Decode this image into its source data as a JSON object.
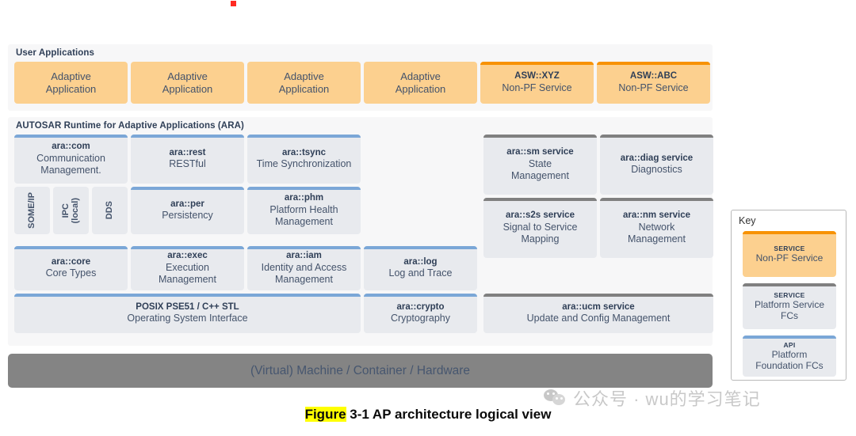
{
  "figure": {
    "caption_highlight": "Figure",
    "caption_rest": " 3-1 AP architecture logical view"
  },
  "watermark": {
    "icon": "wechat-icon",
    "text": "公众号 · wu的学习笔记"
  },
  "colors": {
    "app_fill": "#FCD08F",
    "nonpf_accent": "#F79205",
    "api_fill": "#E8EAEE",
    "api_accent": "#7BA7D7",
    "service_accent": "#808080",
    "panel_bg": "#F7F7F8",
    "hardware_bar": "#848484",
    "caption_highlight": "#FFFF00"
  },
  "user_applications": {
    "title": "User Applications",
    "apps": [
      {
        "kind": "app",
        "title": "",
        "sub": "Adaptive\nApplication"
      },
      {
        "kind": "app",
        "title": "",
        "sub": "Adaptive\nApplication"
      },
      {
        "kind": "app",
        "title": "",
        "sub": "Adaptive\nApplication"
      },
      {
        "kind": "app",
        "title": "",
        "sub": "Adaptive\nApplication"
      },
      {
        "kind": "nonpf",
        "title": "ASW::XYZ",
        "sub": "Non-PF Service"
      },
      {
        "kind": "nonpf",
        "title": "ASW::ABC",
        "sub": "Non-PF Service"
      }
    ]
  },
  "ara": {
    "title": "AUTOSAR Runtime for Adaptive Applications (ARA)",
    "boxes": [
      {
        "kind": "api",
        "title": "ara::com",
        "sub": "Communication\nManagement."
      },
      {
        "kind": "api",
        "title": "ara::rest",
        "sub": "RESTful"
      },
      {
        "kind": "api",
        "title": "ara::tsync",
        "sub": "Time Synchronization"
      },
      {
        "kind": "plain",
        "title": "SOME/IP",
        "sub": ""
      },
      {
        "kind": "plain",
        "title": "IPC\n(local)",
        "sub": ""
      },
      {
        "kind": "plain",
        "title": "DDS",
        "sub": ""
      },
      {
        "kind": "api",
        "title": "ara::per",
        "sub": "Persistency"
      },
      {
        "kind": "api",
        "title": "ara::phm",
        "sub": "Platform Health\nManagement"
      },
      {
        "kind": "api",
        "title": "ara::core",
        "sub": "Core Types"
      },
      {
        "kind": "api",
        "title": "ara::exec",
        "sub": "Execution\nManagement"
      },
      {
        "kind": "api",
        "title": "ara::iam",
        "sub": "Identity and Access\nManagement"
      },
      {
        "kind": "api",
        "title": "ara::log",
        "sub": "Log and Trace"
      },
      {
        "kind": "api",
        "title": "POSIX PSE51 / C++ STL",
        "sub": "Operating System Interface"
      },
      {
        "kind": "api",
        "title": "ara::crypto",
        "sub": "Cryptography"
      },
      {
        "kind": "service",
        "title": "ara::sm service",
        "sub": "State\nManagement"
      },
      {
        "kind": "service",
        "title": "ara::diag service",
        "sub": "Diagnostics"
      },
      {
        "kind": "service",
        "title": "ara::s2s service",
        "sub": "Signal to Service\nMapping"
      },
      {
        "kind": "service",
        "title": "ara::nm service",
        "sub": "Network\nManagement"
      },
      {
        "kind": "service",
        "title": "ara::ucm service",
        "sub": "Update and Config Management"
      }
    ]
  },
  "hardware": {
    "label": "(Virtual) Machine / Container / Hardware"
  },
  "key": {
    "title": "Key",
    "items": [
      {
        "kind": "nonpf",
        "kind_label": "SERVICE",
        "label": "Non-PF Service"
      },
      {
        "kind": "service",
        "kind_label": "SERVICE",
        "label": "Platform Service\nFCs"
      },
      {
        "kind": "api",
        "kind_label": "API",
        "label": "Platform\nFoundation FCs"
      }
    ]
  }
}
